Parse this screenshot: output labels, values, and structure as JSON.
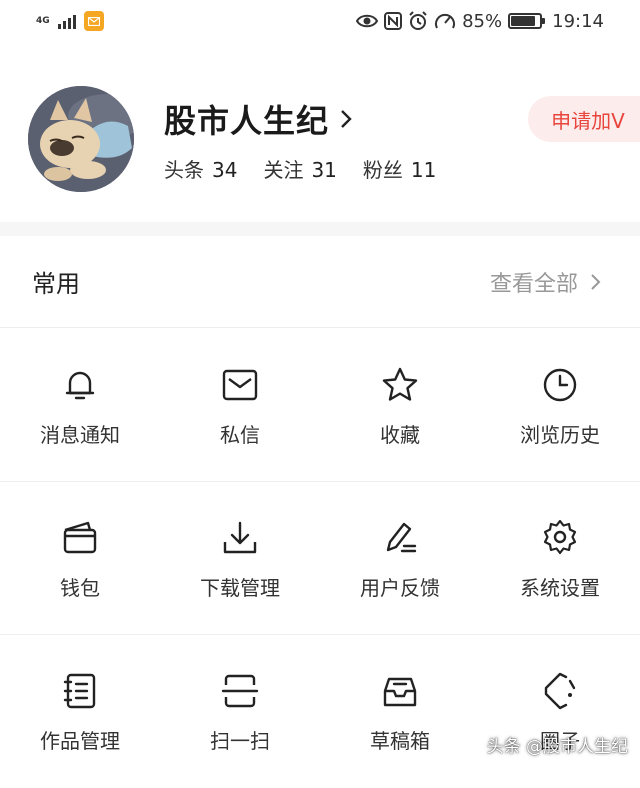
{
  "status_bar": {
    "network": "4G",
    "battery": "85%",
    "battery_level": 0.85,
    "time": "19:14"
  },
  "profile": {
    "name": "股市人生纪",
    "stats": [
      {
        "label": "头条",
        "value": "34"
      },
      {
        "label": "关注",
        "value": "31"
      },
      {
        "label": "粉丝",
        "value": "11"
      }
    ],
    "apply_v": "申请加V"
  },
  "common": {
    "title": "常用",
    "view_all": "查看全部"
  },
  "grid": [
    {
      "label": "消息通知",
      "icon": "bell-icon"
    },
    {
      "label": "私信",
      "icon": "mail-icon"
    },
    {
      "label": "收藏",
      "icon": "star-icon"
    },
    {
      "label": "浏览历史",
      "icon": "clock-icon"
    },
    {
      "label": "钱包",
      "icon": "wallet-icon"
    },
    {
      "label": "下载管理",
      "icon": "download-icon"
    },
    {
      "label": "用户反馈",
      "icon": "pen-icon"
    },
    {
      "label": "系统设置",
      "icon": "gear-icon"
    },
    {
      "label": "作品管理",
      "icon": "notebook-icon"
    },
    {
      "label": "扫一扫",
      "icon": "scan-icon"
    },
    {
      "label": "草稿箱",
      "icon": "draftbox-icon"
    },
    {
      "label": "圈子",
      "icon": "circle-icon"
    }
  ],
  "watermark": "头条 @股市人生纪"
}
